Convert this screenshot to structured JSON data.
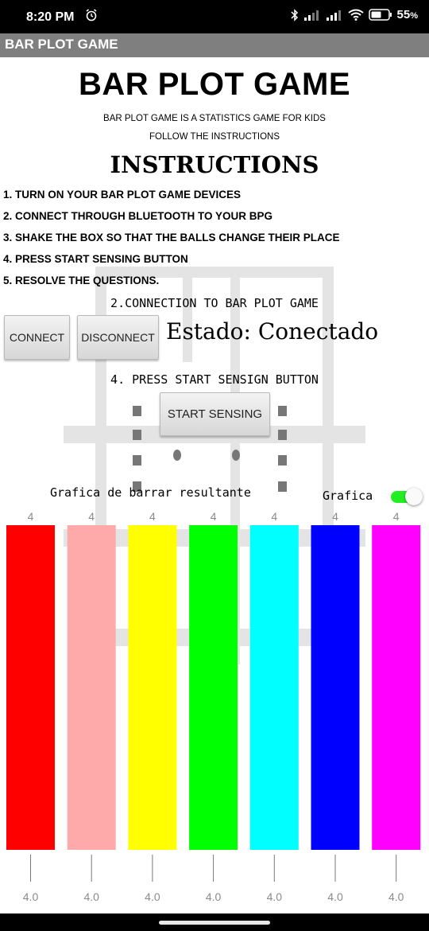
{
  "status_bar": {
    "time": "8:20 PM",
    "battery_pct": "55",
    "battery_unit": "%",
    "icons": [
      "alarm-icon",
      "bluetooth-icon",
      "signal-icon",
      "signal-icon",
      "wifi-icon",
      "battery-icon"
    ]
  },
  "app_bar": {
    "title": "BAR PLOT GAME"
  },
  "header": {
    "title": "BAR PLOT GAME",
    "subtitle1": "BAR PLOT GAME IS A STATISTICS GAME FOR KIDS",
    "subtitle2": "FOLLOW THE INSTRUCTIONS"
  },
  "instructions": {
    "heading": "INSTRUCTIONS",
    "steps": [
      "1. TURN ON YOUR BAR PLOT GAME DEVICES",
      "2. CONNECT THROUGH BLUETOOTH TO YOUR BPG",
      "3. SHAKE THE BOX SO THAT THE BALLS CHANGE THEIR PLACE",
      "4. PRESS START SENSING BUTTON",
      "5. RESOLVE THE QUESTIONS."
    ]
  },
  "connection": {
    "label": "2.CONNECTION TO BAR PLOT GAME",
    "connect_label": "CONNECT",
    "disconnect_label": "DISCONNECT",
    "status": "Estado: Conectado"
  },
  "sensing": {
    "label": "4. PRESS START SENSIGN BUTTON",
    "button_label": "START SENSING"
  },
  "graph": {
    "label": "Grafica de barrar resultante",
    "toggle_label": "Grafica",
    "toggle_on": true
  },
  "chart_data": {
    "type": "bar",
    "values": [
      4,
      4,
      4,
      4,
      4,
      4,
      4
    ],
    "value_labels": [
      "4",
      "4",
      "4",
      "4",
      "4",
      "4",
      "4"
    ],
    "tick_labels": [
      "4.0",
      "4.0",
      "4.0",
      "4.0",
      "4.0",
      "4.0",
      "4.0"
    ],
    "colors": [
      "#ff0000",
      "#ffaaaa",
      "#ffff00",
      "#00ff00",
      "#00ffff",
      "#0000ff",
      "#ff00ff"
    ],
    "ylim": [
      0,
      4
    ]
  }
}
